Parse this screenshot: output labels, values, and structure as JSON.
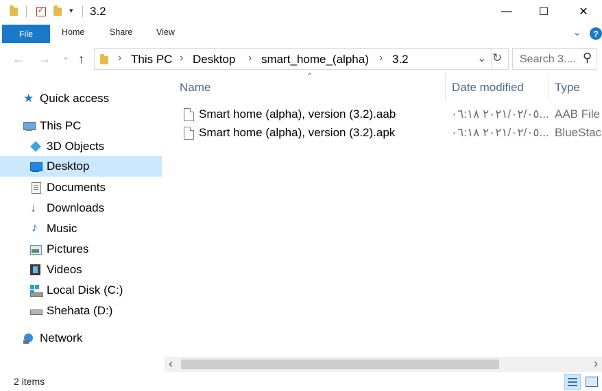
{
  "window": {
    "title": "3.2",
    "minimize_glyph": "—",
    "maximize_glyph": "☐",
    "close_glyph": "✕",
    "quick_access_dropdown_glyph": "▾"
  },
  "ribbon": {
    "tabs": [
      "File",
      "Home",
      "Share",
      "View"
    ],
    "expand_glyph": "⌄",
    "help_glyph": "?",
    "accent_color": "#1979ca"
  },
  "navbar": {
    "back_glyph": "←",
    "forward_glyph": "→",
    "recent_glyph": "⌄",
    "up_glyph": "↑",
    "breadcrumbs": [
      "This PC",
      "Desktop",
      "smart_home_(alpha)",
      "3.2"
    ],
    "crumb_sep": "›",
    "dropdown_glyph": "⌄",
    "refresh_glyph": "↻",
    "search_placeholder": "Search 3....",
    "search_icon_glyph": "⚲"
  },
  "sidebar": {
    "items": [
      {
        "label": "Quick access",
        "icon": "star-icon"
      },
      {
        "label": "This PC",
        "icon": "computer-icon"
      },
      {
        "label": "3D Objects",
        "icon": "cube-icon"
      },
      {
        "label": "Desktop",
        "icon": "desktop-icon",
        "selected": true
      },
      {
        "label": "Documents",
        "icon": "document-icon"
      },
      {
        "label": "Downloads",
        "icon": "download-arrow-icon"
      },
      {
        "label": "Music",
        "icon": "music-note-icon"
      },
      {
        "label": "Pictures",
        "icon": "picture-icon"
      },
      {
        "label": "Videos",
        "icon": "film-icon"
      },
      {
        "label": "Local Disk (C:)",
        "icon": "windows-drive-icon"
      },
      {
        "label": "Shehata (D:)",
        "icon": "drive-icon"
      },
      {
        "label": "Network",
        "icon": "network-icon"
      }
    ]
  },
  "file_list": {
    "sort_glyph": "⌃",
    "columns": [
      "Name",
      "Date modified",
      "Type"
    ],
    "rows": [
      {
        "name": "Smart home (alpha), version (3.2).aab",
        "date": "٢٠٢١/٠٢/٠٥ ٠٦:١٨...",
        "type": "AAB File"
      },
      {
        "name": "Smart home (alpha), version (3.2).apk",
        "date": "٢٠٢١/٠٢/٠٥ ٠٦:١٨...",
        "type": "BlueStacks"
      }
    ]
  },
  "scrollbar": {
    "left_glyph": "‹",
    "right_glyph": "›"
  },
  "status": {
    "item_count": "2 items"
  }
}
